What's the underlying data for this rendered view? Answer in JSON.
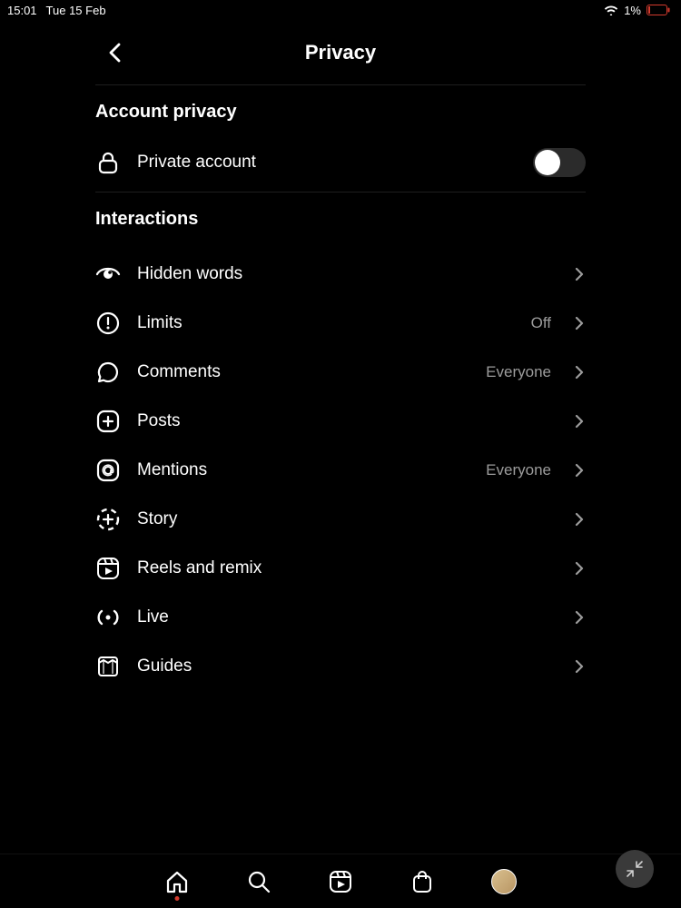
{
  "status": {
    "time": "15:01",
    "date": "Tue 15 Feb",
    "battery": "1%"
  },
  "header": {
    "title": "Privacy"
  },
  "section_account": {
    "title": "Account privacy"
  },
  "private_row": {
    "label": "Private account",
    "enabled": false
  },
  "section_interactions": {
    "title": "Interactions"
  },
  "rows": [
    {
      "icon": "eye-outline-icon",
      "label": "Hidden words",
      "value": ""
    },
    {
      "icon": "exclaim-circle-icon",
      "label": "Limits",
      "value": "Off"
    },
    {
      "icon": "chat-bubble-icon",
      "label": "Comments",
      "value": "Everyone"
    },
    {
      "icon": "plus-square-icon",
      "label": "Posts",
      "value": ""
    },
    {
      "icon": "at-sign-icon",
      "label": "Mentions",
      "value": "Everyone"
    },
    {
      "icon": "story-plus-icon",
      "label": "Story",
      "value": ""
    },
    {
      "icon": "reels-icon",
      "label": "Reels and remix",
      "value": ""
    },
    {
      "icon": "broadcast-icon",
      "label": "Live",
      "value": ""
    },
    {
      "icon": "guides-icon",
      "label": "Guides",
      "value": ""
    }
  ]
}
